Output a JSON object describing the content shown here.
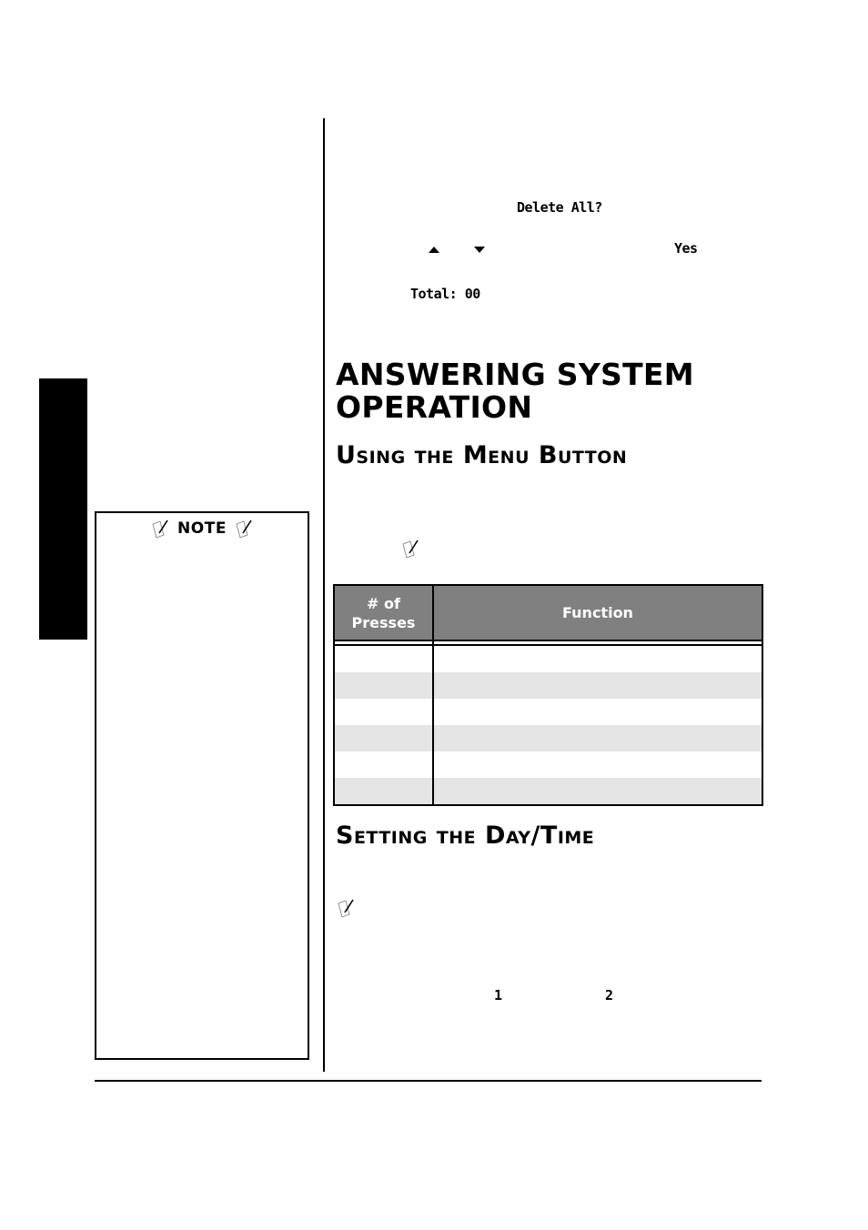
{
  "side_tab": {
    "color": "#000000"
  },
  "note_box": {
    "title": "NOTE",
    "icons": [
      "note-pencil-icon",
      "note-pencil-icon"
    ]
  },
  "display_text": {
    "delete_all_prompt": "Delete All?",
    "yes_option": "Yes",
    "total_readout": "Total: 00",
    "up_arrow": "up-arrow-icon",
    "down_arrow": "down-arrow-icon",
    "digit_one": "1",
    "digit_two": "2"
  },
  "main": {
    "title": "ANSWERING SYSTEM OPERATION",
    "title_line1": "ANSWERING SYSTEM",
    "title_line2": "OPERATION",
    "sections": [
      {
        "heading": "Using the Menu Button"
      },
      {
        "heading": "Setting the Day/Time"
      }
    ]
  },
  "menu_table": {
    "header_bg": "#808080",
    "header_fg": "#ffffff",
    "stripe_color": "#e5e5e5",
    "columns": [
      "# of Presses",
      "Function"
    ],
    "column1_line1": "# of",
    "column1_line2": "Presses",
    "rows": [
      {
        "presses": "",
        "function": ""
      },
      {
        "presses": "",
        "function": ""
      },
      {
        "presses": "",
        "function": ""
      },
      {
        "presses": "",
        "function": ""
      },
      {
        "presses": "",
        "function": ""
      },
      {
        "presses": "",
        "function": ""
      }
    ]
  }
}
